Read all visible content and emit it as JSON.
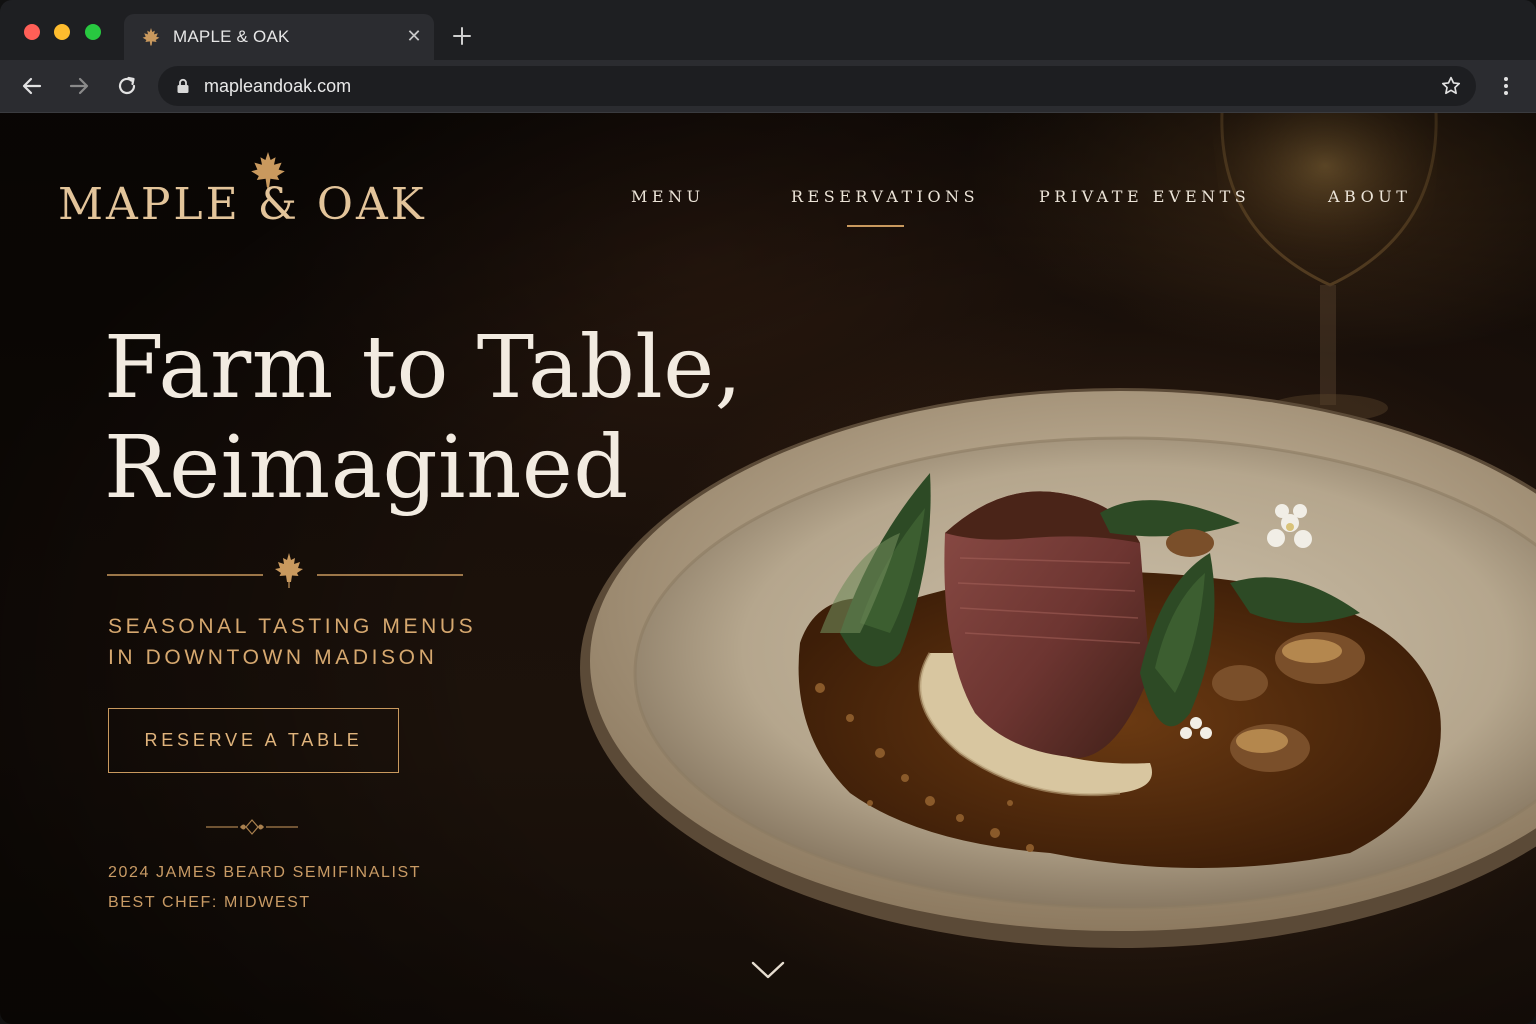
{
  "browser": {
    "tab_title": "MAPLE & OAK",
    "url": "mapleandoak.com",
    "icons": {
      "favicon": "maple-leaf-icon",
      "close": "close-icon",
      "new_tab": "plus-icon",
      "back": "arrow-left-icon",
      "forward": "arrow-right-icon",
      "reload": "reload-icon",
      "lock": "lock-icon",
      "bookmark": "star-icon",
      "menu": "kebab-icon"
    }
  },
  "site": {
    "logo_text": "MAPLE & OAK",
    "nav": {
      "menu": "MENU",
      "reservations": "RESERVATIONS",
      "private_events": "PRIVATE EVENTS",
      "about": "ABOUT",
      "active": "RESERVATIONS"
    },
    "hero": {
      "headline_line1": "Farm to Table,",
      "headline_line2": "Reimagined",
      "tagline_line1": "SEASONAL TASTING MENUS",
      "tagline_line2": "IN DOWNTOWN MADISON",
      "cta_label": "RESERVE A TABLE",
      "award_line1": "2024 JAMES BEARD SEMIFINALIST",
      "award_line2": "BEST CHEF: MIDWEST"
    },
    "colors": {
      "accent_gold": "#c9995e",
      "text_cream": "#f2ebe1",
      "background_dark": "#140d08"
    }
  }
}
